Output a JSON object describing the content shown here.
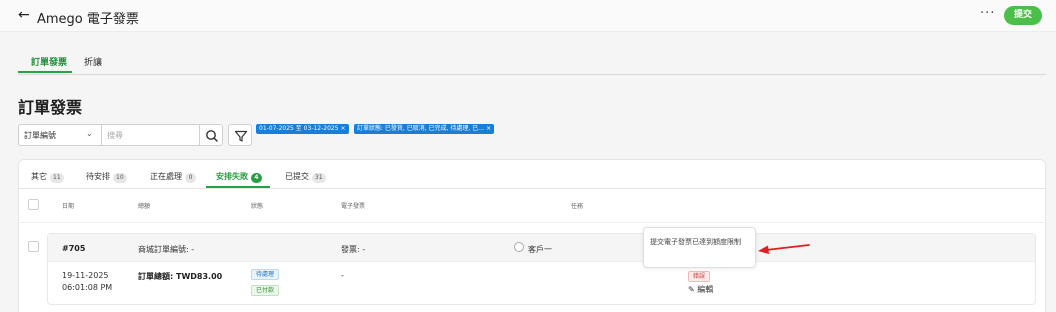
{
  "header": {
    "back_icon": "arrow-left-icon",
    "title": "Amego 電子發票",
    "more_label": "···",
    "submit_label": "提交"
  },
  "main_tabs": [
    {
      "label": "訂單發票",
      "active": true
    },
    {
      "label": "折讓",
      "active": false
    }
  ],
  "page": {
    "heading": "訂單發票"
  },
  "filter": {
    "field_select": "訂單編號",
    "search_placeholder": "搜尋",
    "chips": [
      "01-07-2025 至 03-12-2025 ×",
      "訂單狀態: 已發貨, 已取消, 已完成, 待處理, 已… ×"
    ]
  },
  "sub_tabs": [
    {
      "label": "其它",
      "count": "11",
      "active": false
    },
    {
      "label": "待安排",
      "count": "10",
      "active": false
    },
    {
      "label": "正在處理",
      "count": "0",
      "active": false
    },
    {
      "label": "安排失敗",
      "count": "4",
      "active": true
    },
    {
      "label": "已提交",
      "count": "31",
      "active": false
    }
  ],
  "columns": [
    "日期",
    "總額",
    "狀態",
    "電子發票",
    "任務"
  ],
  "order": {
    "number": "#705",
    "shop_order_label": "商城訂單編號: -",
    "invoice_label": "發票: -",
    "customer": "客戶一",
    "date": "19-11-2025",
    "time": "06:01:08 PM",
    "total_label": "訂單總額: TWD83.00",
    "status_tags": [
      "待處理",
      "已付款"
    ],
    "einvoice_value": "-",
    "task_tag": "錯誤",
    "edit_label": "編輯"
  },
  "tooltip": {
    "text": "提交電子發票已達到額度限制"
  },
  "colors": {
    "brand_green": "#4cbf4a",
    "chip_blue": "#1a7ed6",
    "annotation_red": "#e02020"
  }
}
